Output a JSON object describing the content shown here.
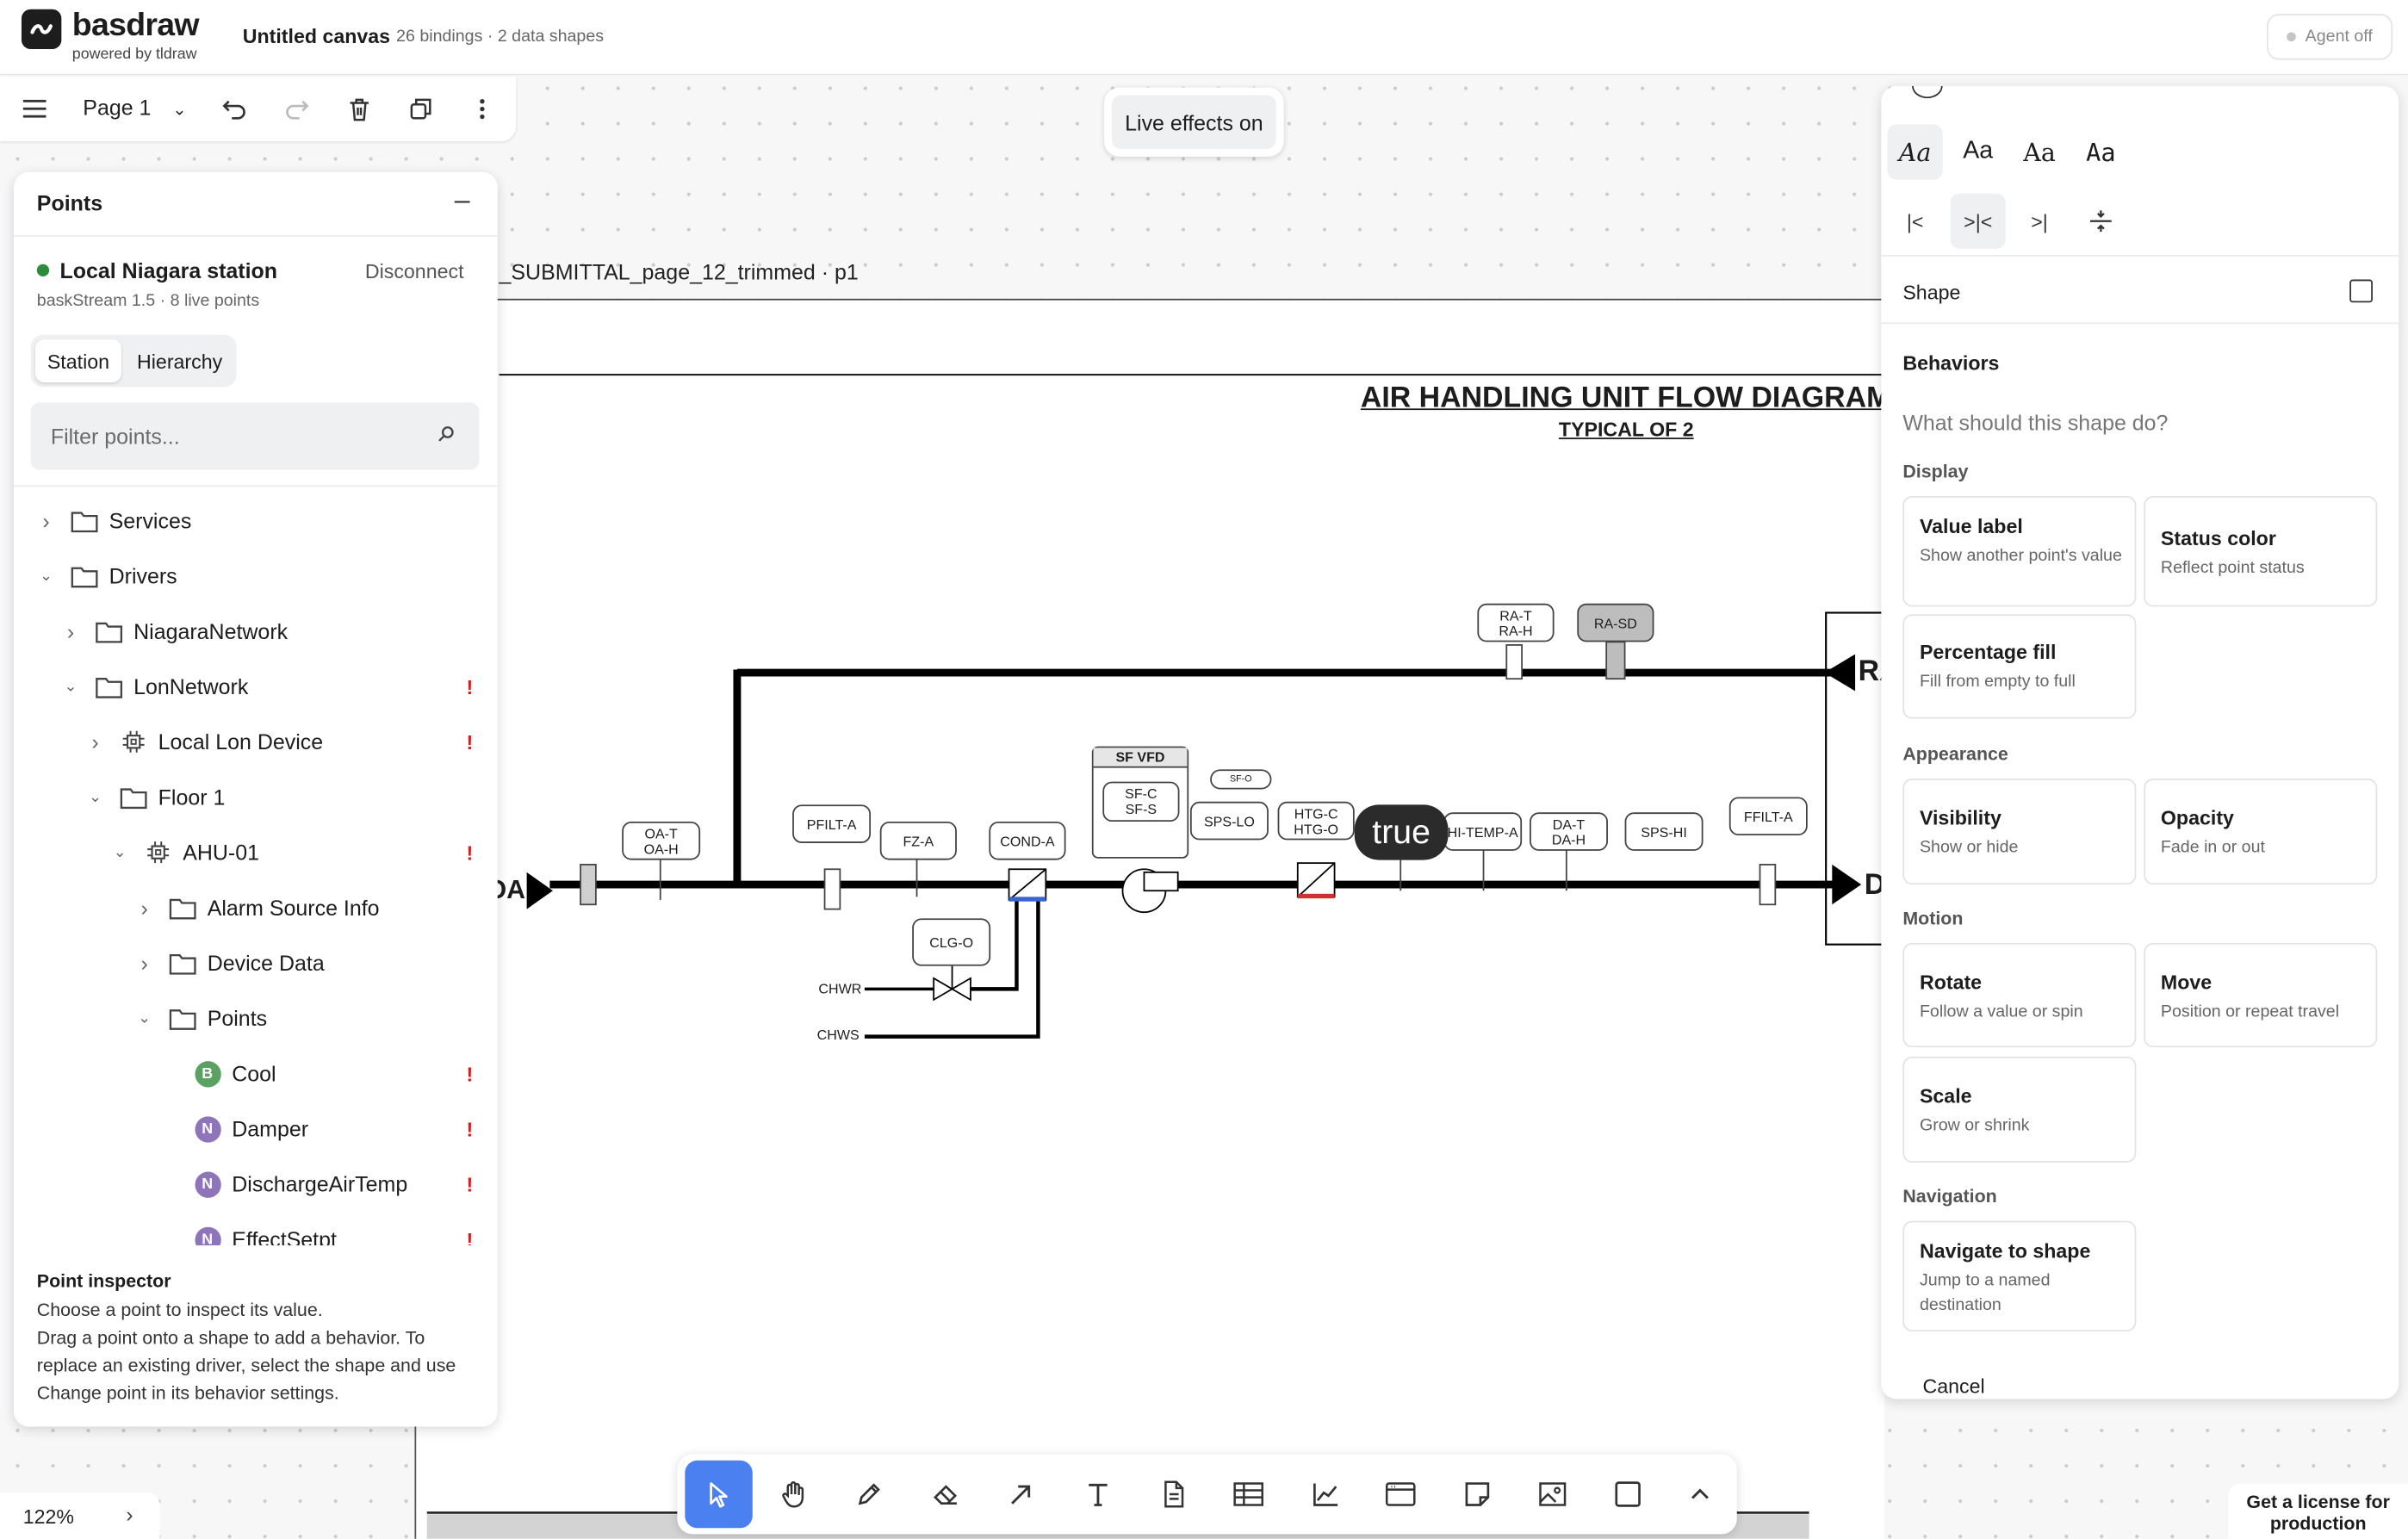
{
  "app": {
    "name": "basdraw",
    "subtitle": "powered by tldraw",
    "canvas_title": "Untitled canvas",
    "canvas_meta": "26 bindings · 2 data shapes",
    "agent_label": "Agent off"
  },
  "toolbar": {
    "page_label": "Page 1",
    "live_effects": "Live effects on"
  },
  "document": {
    "label": "_SUBMITTAL_page_12_trimmed · p1",
    "title": "AIR HANDLING UNIT FLOW DIAGRAM",
    "subtitle": "TYPICAL OF 2",
    "value_badge": "true",
    "tags": {
      "rat": [
        "RA-T",
        "RA-H"
      ],
      "rasd": "RA-SD",
      "oat": [
        "OA-T",
        "OA-H"
      ],
      "pfilt": "PFILT-A",
      "fz": "FZ-A",
      "cond": "COND-A",
      "clg": "CLG-O",
      "sfvfd": "SF VFD",
      "sfcs": [
        "SF-C",
        "SF-S"
      ],
      "sfo": "SF-O",
      "spslo": "SPS-LO",
      "htg": [
        "HTG-C",
        "HTG-O"
      ],
      "hitemp": "HI-TEMP-A",
      "dat": [
        "DA-T",
        "DA-H"
      ],
      "spshi": "SPS-HI",
      "ffilt": "FFILT-A",
      "chwr": "CHWR",
      "chws": "CHWS",
      "oa": "OA",
      "ra": "RA",
      "da": "D"
    }
  },
  "points_panel": {
    "title": "Points",
    "station_name": "Local Niagara station",
    "disconnect": "Disconnect",
    "station_meta": "baskStream 1.5  ·  8 live points",
    "tabs": [
      "Station",
      "Hierarchy"
    ],
    "filter_placeholder": "Filter points...",
    "tree": [
      {
        "label": "Services",
        "kind": "folder",
        "depth": 0,
        "chevron": "right",
        "warn": false
      },
      {
        "label": "Drivers",
        "kind": "folder",
        "depth": 0,
        "chevron": "down",
        "warn": false
      },
      {
        "label": "NiagaraNetwork",
        "kind": "folder",
        "depth": 1,
        "chevron": "right",
        "warn": false
      },
      {
        "label": "LonNetwork",
        "kind": "folder",
        "depth": 1,
        "chevron": "down",
        "warn": true
      },
      {
        "label": "Local Lon Device",
        "kind": "device",
        "depth": 2,
        "chevron": "right",
        "warn": true
      },
      {
        "label": "Floor 1",
        "kind": "folder",
        "depth": 2,
        "chevron": "down",
        "warn": false
      },
      {
        "label": "AHU-01",
        "kind": "device",
        "depth": 3,
        "chevron": "down",
        "warn": true
      },
      {
        "label": "Alarm Source Info",
        "kind": "folder",
        "depth": 4,
        "chevron": "right",
        "warn": false
      },
      {
        "label": "Device Data",
        "kind": "folder",
        "depth": 4,
        "chevron": "right",
        "warn": false
      },
      {
        "label": "Points",
        "kind": "folder",
        "depth": 4,
        "chevron": "down",
        "warn": false
      },
      {
        "label": "Cool",
        "kind": "B",
        "depth": 5,
        "chevron": "",
        "warn": true
      },
      {
        "label": "Damper",
        "kind": "N",
        "depth": 5,
        "chevron": "",
        "warn": true
      },
      {
        "label": "DischargeAirTemp",
        "kind": "N",
        "depth": 5,
        "chevron": "",
        "warn": true
      },
      {
        "label": "EffectSetpt",
        "kind": "N",
        "depth": 5,
        "chevron": "",
        "warn": true
      }
    ],
    "inspector_title": "Point inspector",
    "inspector_text": "Choose a point to inspect its value.\nDrag a point onto a shape to add a behavior. To replace an existing driver, select the shape and use Change point in its behavior settings."
  },
  "behaviors_panel": {
    "font_options": [
      "Aa",
      "Aa",
      "Aa",
      "Aa"
    ],
    "shape_label": "Shape",
    "title": "Behaviors",
    "question": "What should this shape do?",
    "sections": {
      "display": "Display",
      "appearance": "Appearance",
      "motion": "Motion",
      "navigation": "Navigation"
    },
    "cards": {
      "value_label": {
        "title": "Value label",
        "desc": "Show another point's value"
      },
      "status_color": {
        "title": "Status color",
        "desc": "Reflect point status"
      },
      "percentage_fill": {
        "title": "Percentage fill",
        "desc": "Fill from empty to full"
      },
      "visibility": {
        "title": "Visibility",
        "desc": "Show or hide"
      },
      "opacity": {
        "title": "Opacity",
        "desc": "Fade in or out"
      },
      "rotate": {
        "title": "Rotate",
        "desc": "Follow a value or spin"
      },
      "move": {
        "title": "Move",
        "desc": "Position or repeat travel"
      },
      "scale": {
        "title": "Scale",
        "desc": "Grow or shrink"
      },
      "navigate": {
        "title": "Navigate to shape",
        "desc": "Jump to a named destination"
      }
    },
    "cancel": "Cancel"
  },
  "footer": {
    "zoom": "122%",
    "license": "Get a license for production"
  },
  "colors": {
    "accent": "#4a80f0",
    "status_ok": "#2e8b3e",
    "warning": "#d02020",
    "badge_B": "#5aa163",
    "badge_N": "#8e74b8"
  }
}
